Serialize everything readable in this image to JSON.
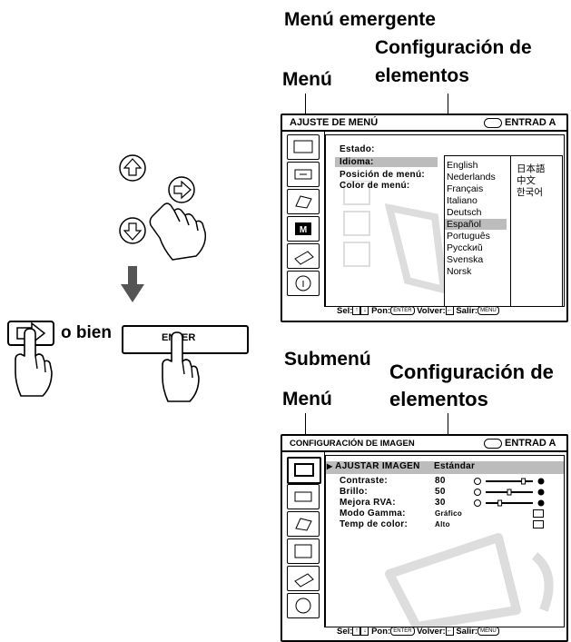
{
  "labels_top": {
    "popup_menu": "Menú emergente",
    "setting_items": "Configuración de",
    "setting_items_2": "elementos",
    "menu": "Menú"
  },
  "labels_bottom": {
    "submenu": "Submenú",
    "setting_items": "Configuración de",
    "setting_items_2": "elementos",
    "menu": "Menú"
  },
  "buttons": {
    "or_text": "o bien",
    "enter_label": "ENTER"
  },
  "menu_panel": {
    "title": "AJUSTE DE MENÚ",
    "input": "ENTRAD A",
    "items": [
      "Estado:",
      "Idioma:",
      "Posición de menú:",
      "Color de menú:"
    ],
    "languages_left": [
      "English",
      "Nederlands",
      "Français",
      "Italiano",
      "Deutsch",
      "Español",
      "Português",
      "Pycckиŭ",
      "Svenska",
      "Norsk"
    ],
    "languages_right": [
      "日本語",
      "中文",
      "한국어"
    ],
    "selected_language": "Español",
    "footer": {
      "sel": "Sel:",
      "pon": "Pon:",
      "enter_key": "ENTER",
      "volver": "Volver:",
      "salir": "Salir:",
      "menu_key": "MENU"
    }
  },
  "image_panel": {
    "title": "CONFIGURACIÓN DE IMAGEN",
    "input": "ENTRAD A",
    "header_item": "AJUSTAR IMAGEN",
    "header_value": "Estándar",
    "rows": [
      {
        "label": "Contraste:",
        "value": "80",
        "level": 0.8
      },
      {
        "label": "Brillo:",
        "value": "50",
        "level": 0.5
      },
      {
        "label": "Mejora RVA:",
        "value": "30",
        "level": 0.3
      },
      {
        "label": "Modo Gamma:",
        "value": "Gráfico"
      },
      {
        "label": "Temp de color:",
        "value": "Alto"
      }
    ],
    "footer": {
      "sel": "Sel:",
      "pon": "Pon:",
      "enter_key": "ENTER",
      "volver": "Volver:",
      "salir": "Salir:",
      "menu_key": "MENU"
    }
  }
}
